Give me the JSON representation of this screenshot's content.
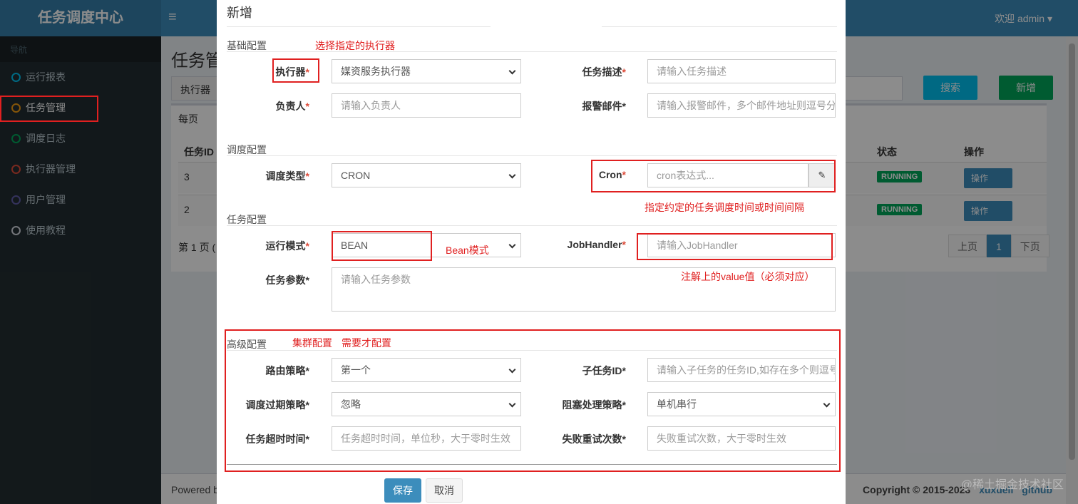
{
  "header": {
    "logo": "任务调度中心",
    "menu_toggle": "≡",
    "user": "欢迎 admin ▾"
  },
  "sidebar": {
    "heading": "导航",
    "items": [
      {
        "label": "运行报表",
        "color": "#00c0ef"
      },
      {
        "label": "任务管理",
        "color": "#f39c12"
      },
      {
        "label": "调度日志",
        "color": "#00a65a"
      },
      {
        "label": "执行器管理",
        "color": "#dd4b39"
      },
      {
        "label": "用户管理",
        "color": "#605ca8"
      },
      {
        "label": "使用教程",
        "color": "#d2d6de"
      }
    ]
  },
  "background": {
    "page_title": "任务管",
    "search_label": "执行器",
    "search_button": "搜索",
    "add_button": "新增",
    "per_page": "每页",
    "per_page_value": "1(",
    "columns": [
      "任务ID",
      "状态",
      "操作"
    ],
    "rows": [
      {
        "id": "3",
        "status": "RUNNING",
        "op": "操作"
      },
      {
        "id": "2",
        "status": "RUNNING",
        "op": "操作"
      }
    ],
    "page_info": "第 1 页 (",
    "pager": {
      "prev": "上页",
      "current": "1",
      "next": "下页"
    },
    "footer_left": "Powered b",
    "footer_right": "Copyright © 2015-2023",
    "footer_links": [
      "xuxueli",
      "github"
    ],
    "watermark": "@稀土掘金技术社区"
  },
  "modal": {
    "title": "新增",
    "sections": {
      "basic": "基础配置",
      "schedule": "调度配置",
      "task": "任务配置",
      "advanced": "高级配置"
    },
    "fields": {
      "executor": {
        "label": "执行器",
        "value": "媒资服务执行器"
      },
      "job_desc": {
        "label": "任务描述",
        "placeholder": "请输入任务描述"
      },
      "author": {
        "label": "负责人",
        "placeholder": "请输入负责人"
      },
      "alarm_email": {
        "label": "报警邮件",
        "placeholder": "请输入报警邮件，多个邮件地址则逗号分"
      },
      "schedule_type": {
        "label": "调度类型",
        "value": "CRON"
      },
      "cron": {
        "label": "Cron",
        "placeholder": "cron表达式..."
      },
      "glue_type": {
        "label": "运行模式",
        "value": "BEAN"
      },
      "job_handler": {
        "label": "JobHandler",
        "placeholder": "请输入JobHandler"
      },
      "job_param": {
        "label": "任务参数",
        "placeholder": "请输入任务参数"
      },
      "route_strategy": {
        "label": "路由策略",
        "value": "第一个"
      },
      "child_job": {
        "label": "子任务ID",
        "placeholder": "请输入子任务的任务ID,如存在多个则逗号"
      },
      "misfire": {
        "label": "调度过期策略",
        "value": "忽略"
      },
      "block_strategy": {
        "label": "阻塞处理策略",
        "value": "单机串行"
      },
      "timeout": {
        "label": "任务超时时间",
        "placeholder": "任务超时时间，单位秒，大于零时生效"
      },
      "fail_retry": {
        "label": "失败重试次数",
        "placeholder": "失败重试次数，大于零时生效"
      }
    },
    "save": "保存",
    "cancel": "取消"
  },
  "annotations": {
    "executor_note": "选择指定的执行器",
    "cron_note": "指定约定的任务调度时间或时间间隔",
    "bean_note": "Bean模式",
    "handler_note": "注解上的value值（必须对应）",
    "cluster_note": "集群配置",
    "cluster_note2": "需要才配置"
  }
}
